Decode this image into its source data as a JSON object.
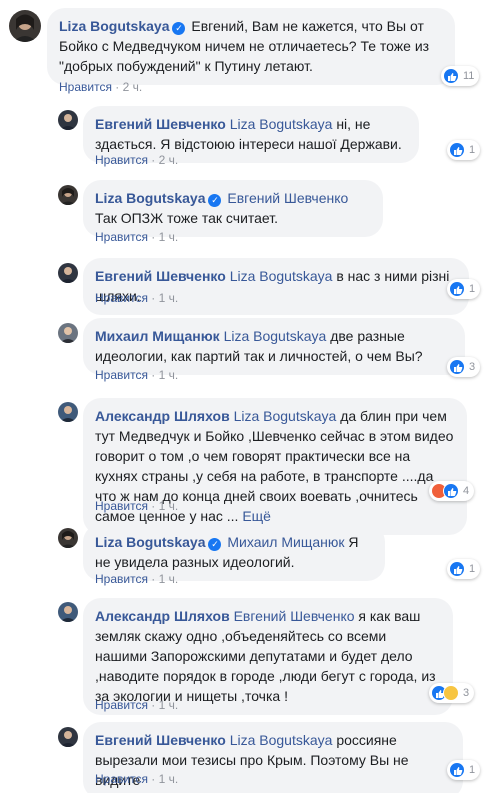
{
  "reply_label": "Нравится",
  "sep": "·",
  "more_label": "Ещё",
  "comments": [
    {
      "author": "Liza Bogutskaya",
      "verified": true,
      "mention": "",
      "text": "Евгений, Вам не кажется, что Вы от Бойко с Медведчуком ничем не отличаетесь? Те тоже из \"добрых побуждений\" к Путину летают.",
      "time": "2 ч.",
      "reaction_count": "11",
      "reactions": [
        "like"
      ]
    },
    {
      "author": "Евгений Шевченко",
      "verified": false,
      "mention": "Liza Bogutskaya",
      "text": "ні, не здається. Я відстоюю інтереси нашої Держави.",
      "time": "2 ч.",
      "reaction_count": "1",
      "reactions": [
        "like"
      ]
    },
    {
      "author": "Liza Bogutskaya",
      "verified": true,
      "mention": "Евгений Шевченко",
      "text": "Так ОПЗЖ тоже так считает.",
      "time": "1 ч.",
      "reaction_count": "",
      "reactions": []
    },
    {
      "author": "Евгений Шевченко",
      "verified": false,
      "mention": "Liza Bogutskaya",
      "text": "в нас з ними різні шляхи.",
      "time": "1 ч.",
      "reaction_count": "1",
      "reactions": [
        "like"
      ]
    },
    {
      "author": "Михаил Мищанюк",
      "verified": false,
      "mention": "Liza Bogutskaya",
      "text": "две разные идеологии, как партий так и личностей, о чем Вы?",
      "time": "1 ч.",
      "reaction_count": "3",
      "reactions": [
        "like"
      ]
    },
    {
      "author": "Александр Шляхов",
      "verified": false,
      "mention": "Liza Bogutskaya",
      "text": "да блин при чем тут Медведчук и Бойко ,Шевченко сейчас в этом видео говорит о том ,о чем говорят практически все на кухнях страны ,у себя на работе, в транспорте ....да что ж нам до конца дней своих воевать ,очнитесь самое ценное у нас ...",
      "time": "1 ч.",
      "reaction_count": "4",
      "reactions": [
        "angry",
        "like"
      ],
      "has_more": true
    },
    {
      "author": "Liza Bogutskaya",
      "verified": true,
      "mention": "Михаил Мищанюк",
      "text": "Я не увидела разных идеологий.",
      "time": "1 ч.",
      "reaction_count": "1",
      "reactions": [
        "like"
      ]
    },
    {
      "author": "Александр Шляхов",
      "verified": false,
      "mention": "Евгений Шевченко",
      "text": "я как ваш земляк скажу одно ,объеденяйтесь со всеми нашими Запорожскими депутатами и будет дело ,наводите порядок в городе ,люди бегут с города, из за экологии и нищеты ,точка !",
      "time": "1 ч.",
      "reaction_count": "3",
      "reactions": [
        "like",
        "haha"
      ]
    },
    {
      "author": "Евгений Шевченко",
      "verified": false,
      "mention": "Liza Bogutskaya",
      "text": "россияне вырезали мои тезисы про Крым. Поэтому Вы не видите",
      "time": "1 ч.",
      "reaction_count": "1",
      "reactions": [
        "like"
      ]
    }
  ]
}
